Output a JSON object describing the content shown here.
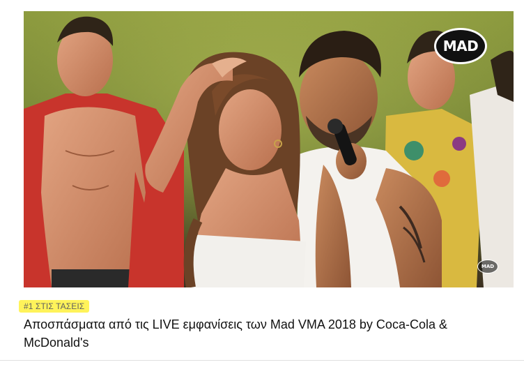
{
  "video": {
    "channel_logo_text": "MAD",
    "watermark_text": "MAD",
    "badge": "#1 ΣΤΙΣ ΤΑΣΕΙΣ",
    "title": "Αποσπάσματα από τις LIVE εμφανίσεις των Mad VMA 2018 by Coca-Cola & McDonald's"
  },
  "colors": {
    "badge_highlight": "#fff35a",
    "badge_text": "#606060",
    "title_text": "#111111",
    "stage_background": "#7a8a38"
  }
}
